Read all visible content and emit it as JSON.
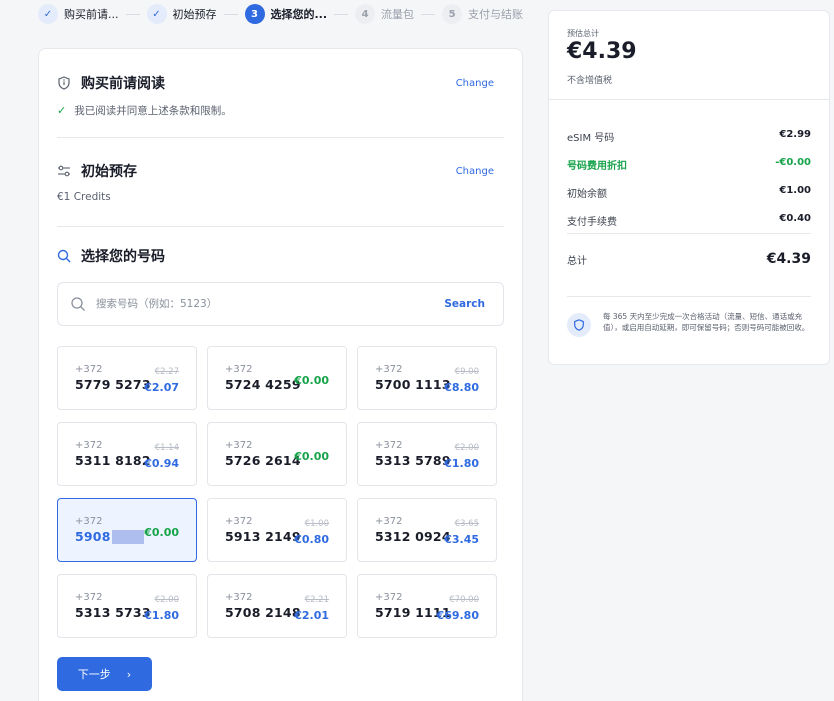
{
  "stepper": {
    "steps": [
      {
        "label": "购买前请...",
        "state": "done",
        "marker": "✓"
      },
      {
        "label": "初始预存",
        "state": "done",
        "marker": "✓"
      },
      {
        "label": "选择您的...",
        "state": "current",
        "marker": "3"
      },
      {
        "label": "流量包",
        "state": "todo",
        "marker": "4"
      },
      {
        "label": "支付与结账",
        "state": "todo",
        "marker": "5"
      }
    ]
  },
  "sections": {
    "read": {
      "title": "购买前请阅读",
      "change": "Change",
      "confirm_text": "我已阅读并同意上述条款和限制。",
      "check_mark": "✓"
    },
    "deposit": {
      "title": "初始预存",
      "change": "Change",
      "value": "€1 Credits"
    },
    "choose": {
      "title": "选择您的号码",
      "search_placeholder": "搜索号码（例如：5123）",
      "search_button": "Search"
    }
  },
  "numbers": [
    {
      "cc": "+372",
      "number": "5779 5273",
      "old": "€2.27",
      "price": "€2.07",
      "free": false
    },
    {
      "cc": "+372",
      "number": "5724 4259",
      "old": "",
      "price": "€0.00",
      "free": true
    },
    {
      "cc": "+372",
      "number": "5700 1113",
      "old": "€9.00",
      "price": "€8.80",
      "free": false
    },
    {
      "cc": "+372",
      "number": "5311 8182",
      "old": "€1.14",
      "price": "€0.94",
      "free": false
    },
    {
      "cc": "+372",
      "number": "5726 2614",
      "old": "",
      "price": "€0.00",
      "free": true
    },
    {
      "cc": "+372",
      "number": "5313 5789",
      "old": "€2.00",
      "price": "€1.80",
      "free": false
    },
    {
      "cc": "+372",
      "number": "5908",
      "old": "",
      "price": "€0.00",
      "free": true,
      "selected": true,
      "masked": true
    },
    {
      "cc": "+372",
      "number": "5913 2149",
      "old": "€1.00",
      "price": "€0.80",
      "free": false
    },
    {
      "cc": "+372",
      "number": "5312 0924",
      "old": "€3.65",
      "price": "€3.45",
      "free": false
    },
    {
      "cc": "+372",
      "number": "5313 5733",
      "old": "€2.00",
      "price": "€1.80",
      "free": false
    },
    {
      "cc": "+372",
      "number": "5708 2148",
      "old": "€2.21",
      "price": "€2.01",
      "free": false
    },
    {
      "cc": "+372",
      "number": "5719 1111",
      "old": "€70.00",
      "price": "€69.80",
      "free": false
    }
  ],
  "next_button": {
    "label": "下一步",
    "arrow": "›"
  },
  "summary": {
    "label": "预估总计",
    "total": "€4.39",
    "tax_note": "不含增值税",
    "lines": [
      {
        "label": "eSIM 号码",
        "value": "€2.99",
        "discount": false
      },
      {
        "label": "号码费用折扣",
        "value": "-€0.00",
        "discount": true
      },
      {
        "label": "初始余额",
        "value": "€1.00",
        "discount": false
      },
      {
        "label": "支付手续费",
        "value": "€0.40",
        "discount": false
      }
    ],
    "grand_label": "总计",
    "grand_value": "€4.39",
    "notice": "每 365 天内至少完成一次合格活动（流量、短信、通话或充值），或启用自动延期，即可保留号码；否则号码可能被回收。"
  },
  "colors": {
    "accent": "#2f6ae0",
    "success": "#16a34a",
    "muted": "#9aa0ac"
  }
}
